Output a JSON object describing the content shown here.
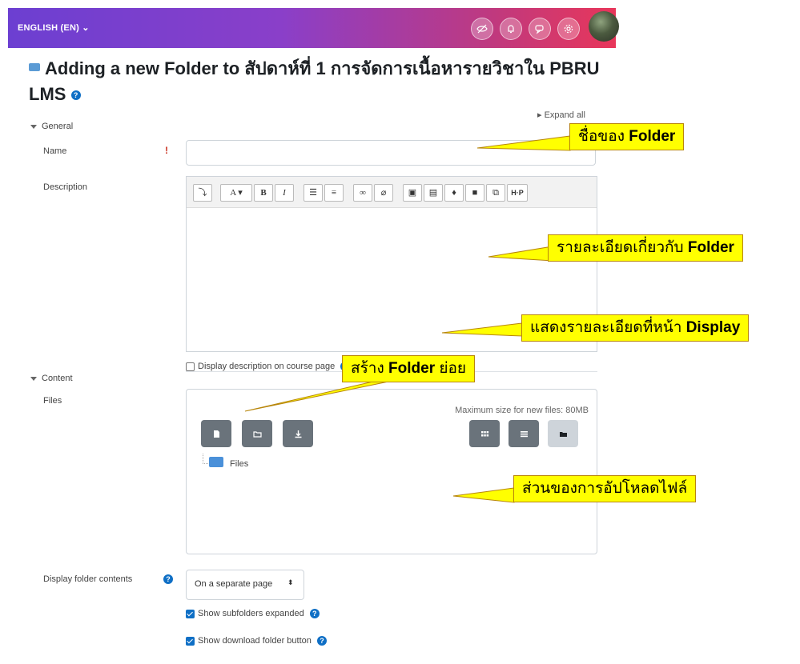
{
  "topbar": {
    "language": "ENGLISH (EN) ⌄",
    "icons": [
      "eye-off-icon",
      "bell-icon",
      "chat-icon",
      "gear-icon"
    ]
  },
  "heading": {
    "title": "Adding a new Folder to สัปดาห์ที่ 1 การจัดการเนื้อหารายวิชาใน PBRU LMS"
  },
  "expand_all": "Expand all",
  "general": {
    "section": "General",
    "name_label": "Name",
    "name_value": "",
    "description_label": "Description",
    "display_description": "Display description on course page"
  },
  "content": {
    "section": "Content",
    "files_label": "Files",
    "max_size": "Maximum size for new files: 80MB",
    "files_folder": "Files",
    "display_label": "Display folder contents",
    "display_value": "On a separate page",
    "show_subfolders": "Show subfolders expanded",
    "show_download": "Show download folder button"
  },
  "callouts": {
    "name": {
      "prefix": "ชื่อของ ",
      "bold": "Folder"
    },
    "description": {
      "prefix": "รายละเอียดเกี่ยวกับ ",
      "bold": "Folder"
    },
    "display": {
      "prefix": "แสดงรายละเอียดที่หน้า ",
      "bold": "Display"
    },
    "subfolder": {
      "prefix": "สร้าง ",
      "bold": "Folder",
      "suffix": " ย่อย"
    },
    "upload": {
      "prefix": "ส่วนของการอัปโหลดไฟล์"
    }
  },
  "colors": {
    "accent": "#0f6fc5",
    "required": "#ca3120",
    "callout": "#ffff00",
    "topbar_start": "#6c3fd1",
    "topbar_end": "#e8365a"
  }
}
